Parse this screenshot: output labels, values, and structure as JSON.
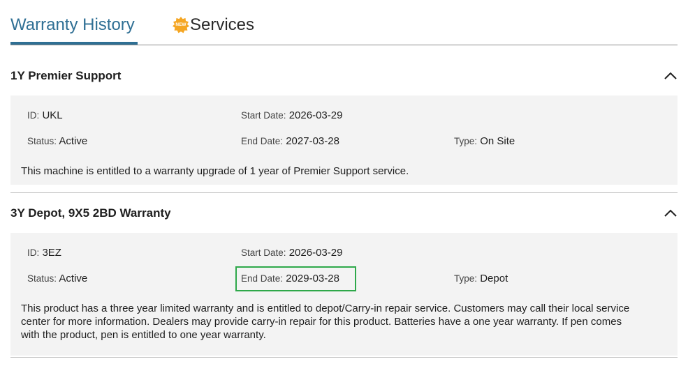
{
  "tabs": {
    "warranty_history": "Warranty History",
    "services": "Services",
    "new_badge": "NEW"
  },
  "sections": [
    {
      "title": "1Y Premier Support",
      "id_label": "ID:",
      "id_value": "UKL",
      "start_label": "Start Date:",
      "start_value": "2026-03-29",
      "status_label": "Status:",
      "status_value": "Active",
      "end_label": "End Date:",
      "end_value": "2027-03-28",
      "type_label": "Type:",
      "type_value": "On Site",
      "description": "This machine is entitled to a warranty upgrade of 1 year of Premier Support service."
    },
    {
      "title": "3Y Depot, 9X5 2BD Warranty",
      "id_label": "ID:",
      "id_value": "3EZ",
      "start_label": "Start Date:",
      "start_value": "2026-03-29",
      "status_label": "Status:",
      "status_value": "Active",
      "end_label": "End Date:",
      "end_value": "2029-03-28",
      "type_label": "Type:",
      "type_value": "Depot",
      "description_lines": [
        "This product has a three year limited warranty and is entitled to depot/Carry-in repair service. Customers may call their local service",
        "center for more information. Dealers may provide carry-in repair for this product. Batteries have a one year warranty. If pen comes",
        "with the product, pen is entitled to one year warranty."
      ]
    }
  ],
  "colors": {
    "accent": "#2f6f94",
    "highlight": "#2ea84a",
    "panel_bg": "#f3f3f3",
    "badge": "#f5a623"
  },
  "icons": [
    "new-badge-icon",
    "chevron-up-icon"
  ]
}
